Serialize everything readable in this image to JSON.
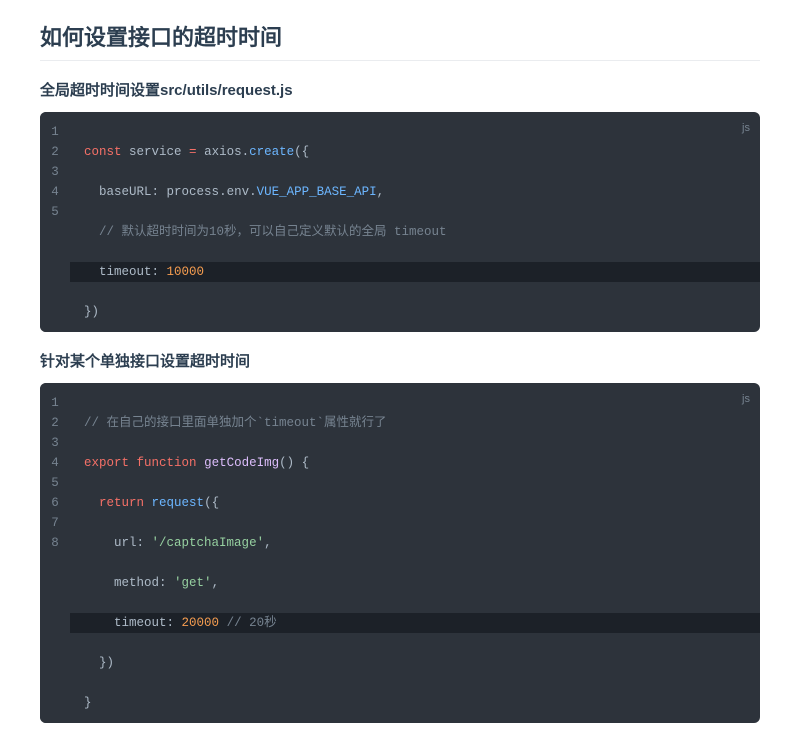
{
  "page": {
    "title": "如何设置接口的超时时间",
    "sections": [
      {
        "heading": "全局超时时间设置src/utils/request.js"
      },
      {
        "heading": "针对某个单独接口设置超时时间"
      }
    ]
  },
  "codeblocks": [
    {
      "lang": "js",
      "line_numbers": [
        "1",
        "2",
        "3",
        "4",
        "5"
      ],
      "tokens": {
        "l1": {
          "kw_const": "const",
          "sp": " ",
          "name": "service",
          "eq": " = ",
          "obj": "axios",
          "dot": ".",
          "fn": "create",
          "lp": "(",
          "lb": "{"
        },
        "l2": {
          "indent": "  ",
          "key": "baseURL",
          "colon": ": ",
          "proc": "process",
          "d1": ".",
          "env": "env",
          "d2": ".",
          "prop": "VUE_APP_BASE_API",
          "comma": ","
        },
        "l3": {
          "indent": "  ",
          "comment": "// 默认超时时间为10秒，可以自己定义默认的全局 timeout"
        },
        "l4": {
          "indent": "  ",
          "key": "timeout",
          "colon": ": ",
          "num": "10000"
        },
        "l5": {
          "rb": "}",
          "rp": ")"
        }
      }
    },
    {
      "lang": "js",
      "line_numbers": [
        "1",
        "2",
        "3",
        "4",
        "5",
        "6",
        "7",
        "8"
      ],
      "tokens": {
        "l1": {
          "comment": "// 在自己的接口里面单独加个`timeout`属性就行了"
        },
        "l2": {
          "kw_export": "export",
          "sp1": " ",
          "kw_func": "function",
          "sp2": " ",
          "fname": "getCodeImg",
          "lp": "(",
          "rp": ")",
          "sp3": " ",
          "lb": "{"
        },
        "l3": {
          "indent": "  ",
          "kw_return": "return",
          "sp": " ",
          "call": "request",
          "lp": "(",
          "lb": "{"
        },
        "l4": {
          "indent": "    ",
          "key": "url",
          "colon": ": ",
          "str": "'/captchaImage'",
          "comma": ","
        },
        "l5": {
          "indent": "    ",
          "key": "method",
          "colon": ": ",
          "str": "'get'",
          "comma": ","
        },
        "l6": {
          "indent": "    ",
          "key": "timeout",
          "colon": ": ",
          "num": "20000",
          "sp": " ",
          "comment": "// 20秒"
        },
        "l7": {
          "indent": "  ",
          "rb": "}",
          "rp": ")"
        },
        "l8": {
          "rb": "}"
        }
      }
    }
  ]
}
